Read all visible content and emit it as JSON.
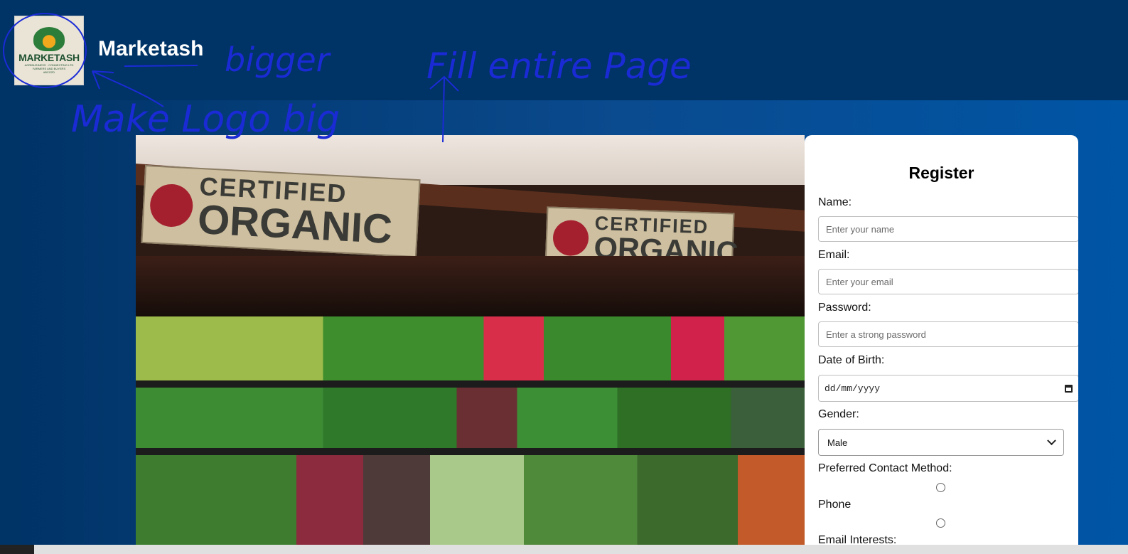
{
  "header": {
    "title": "Marketash",
    "logo": {
      "brand": "MARKETASH",
      "tagline": "AGRIBUSINESS · CONNECTING LTD",
      "subtag": "FARMERS AND BUYERS",
      "code": "#BCO2D"
    }
  },
  "hero": {
    "sign_line1": "CERTIFIED",
    "sign_line2": "ORGANIC"
  },
  "form": {
    "title": "Register",
    "name_label": "Name:",
    "name_placeholder": "Enter your name",
    "email_label": "Email:",
    "email_placeholder": "Enter your email",
    "password_label": "Password:",
    "password_placeholder": "Enter a strong password",
    "dob_label": "Date of Birth:",
    "dob_value": "dd/mm/yyyy",
    "gender_label": "Gender:",
    "gender_selected": "Male",
    "contact_label": "Preferred Contact Method:",
    "contact_options": [
      "Phone"
    ],
    "interests_label": "Email Interests:"
  },
  "annotations": {
    "note_logo": "Make Logo big",
    "note_title": "bigger",
    "note_page": "Fill entire Page"
  },
  "colors": {
    "header_bg": "#003366",
    "main_bg_right": "#0055a5",
    "annotation_ink": "#1a2bd6"
  }
}
